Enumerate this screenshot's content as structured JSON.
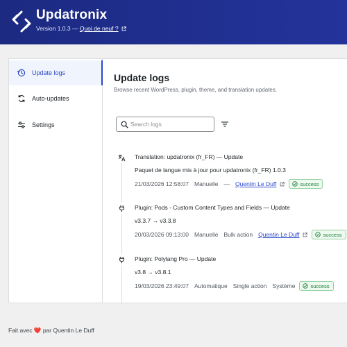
{
  "header": {
    "title": "Updatronix",
    "version_text": "Version 1.0.3 — ",
    "whats_new_link": "Quoi de neuf ?"
  },
  "sidebar": {
    "items": [
      {
        "label": "Update logs",
        "icon": "history-icon",
        "active": true
      },
      {
        "label": "Auto-updates",
        "icon": "refresh-icon",
        "active": false
      },
      {
        "label": "Settings",
        "icon": "sliders-icon",
        "active": false
      }
    ]
  },
  "main": {
    "title": "Update logs",
    "description": "Browse recent WordPress, plugin, theme, and translation updates.",
    "search_placeholder": "Search logs",
    "entries": [
      {
        "icon": "translation-icon",
        "title": "Translation: updatronix (fr_FR) — Update",
        "detail": "Paquet de langue mis à jour pour updatronix (fr_FR) 1.0.3",
        "date": "21/03/2026 12:58:07",
        "mode": "Manuelle",
        "action": "—",
        "author": "Quentin Le Duff",
        "status": "success"
      },
      {
        "icon": "plug-icon",
        "title": "Plugin: Pods - Custom Content Types and Fields — Update",
        "detail": "v3.3.7 → v3.3.8",
        "date": "20/03/2026 09:13:00",
        "mode": "Manuelle",
        "action": "Bulk action",
        "author": "Quentin Le Duff",
        "status": "success"
      },
      {
        "icon": "plug-icon",
        "title": "Plugin: Polylang Pro — Update",
        "detail": "v3.8 → v3.8.1",
        "date": "19/03/2026 23:49:07",
        "mode": "Automatique",
        "action": "Single action",
        "author": "Système",
        "status": "success"
      }
    ]
  },
  "footer": {
    "prefix": "Fait avec",
    "suffix": "par Quentin Le Duff"
  },
  "colors": {
    "header_bg": "#1c2a82",
    "accent": "#2a47c7",
    "success": "#1a7f37",
    "heart": "#d63638"
  }
}
